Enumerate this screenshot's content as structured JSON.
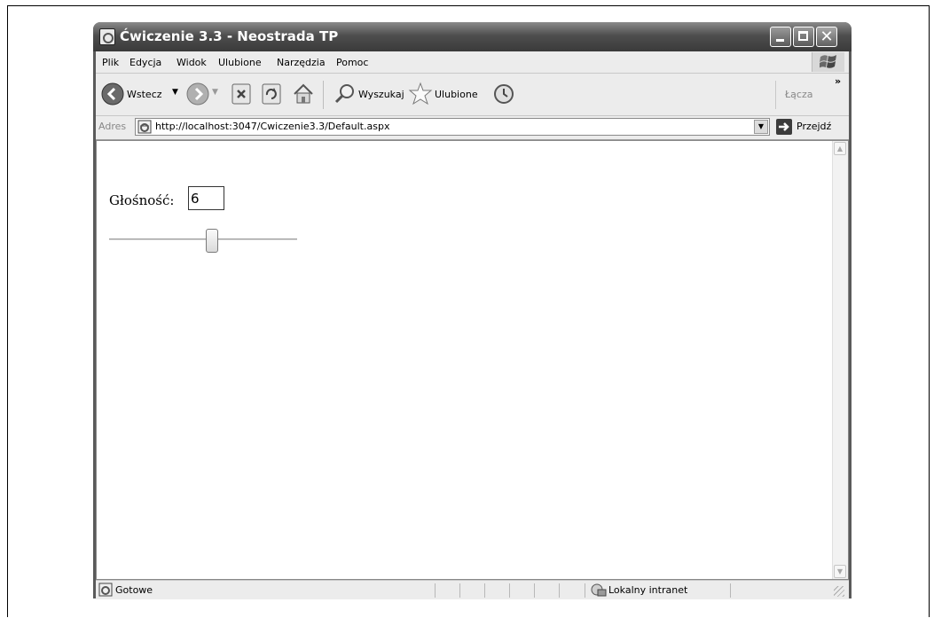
{
  "window": {
    "title": "Ćwiczenie 3.3 - Neostrada TP"
  },
  "menubar": {
    "items": [
      "Plik",
      "Edycja",
      "Widok",
      "Ulubione",
      "Narzędzia",
      "Pomoc"
    ]
  },
  "toolbar": {
    "back_label": "Wstecz",
    "search_label": "Wyszukaj",
    "favorites_label": "Ulubione",
    "links_label": "Łącza",
    "overflow": "»"
  },
  "address": {
    "label": "Adres",
    "url": "http://localhost:3047/Cwiczenie3.3/Default.aspx",
    "go_label": "Przejdź"
  },
  "page": {
    "volume_label": "Głośność:",
    "volume_value": "6",
    "slider": {
      "min": 0,
      "max": 10,
      "value": 6
    }
  },
  "status": {
    "text": "Gotowe",
    "zone": "Lokalny intranet"
  }
}
